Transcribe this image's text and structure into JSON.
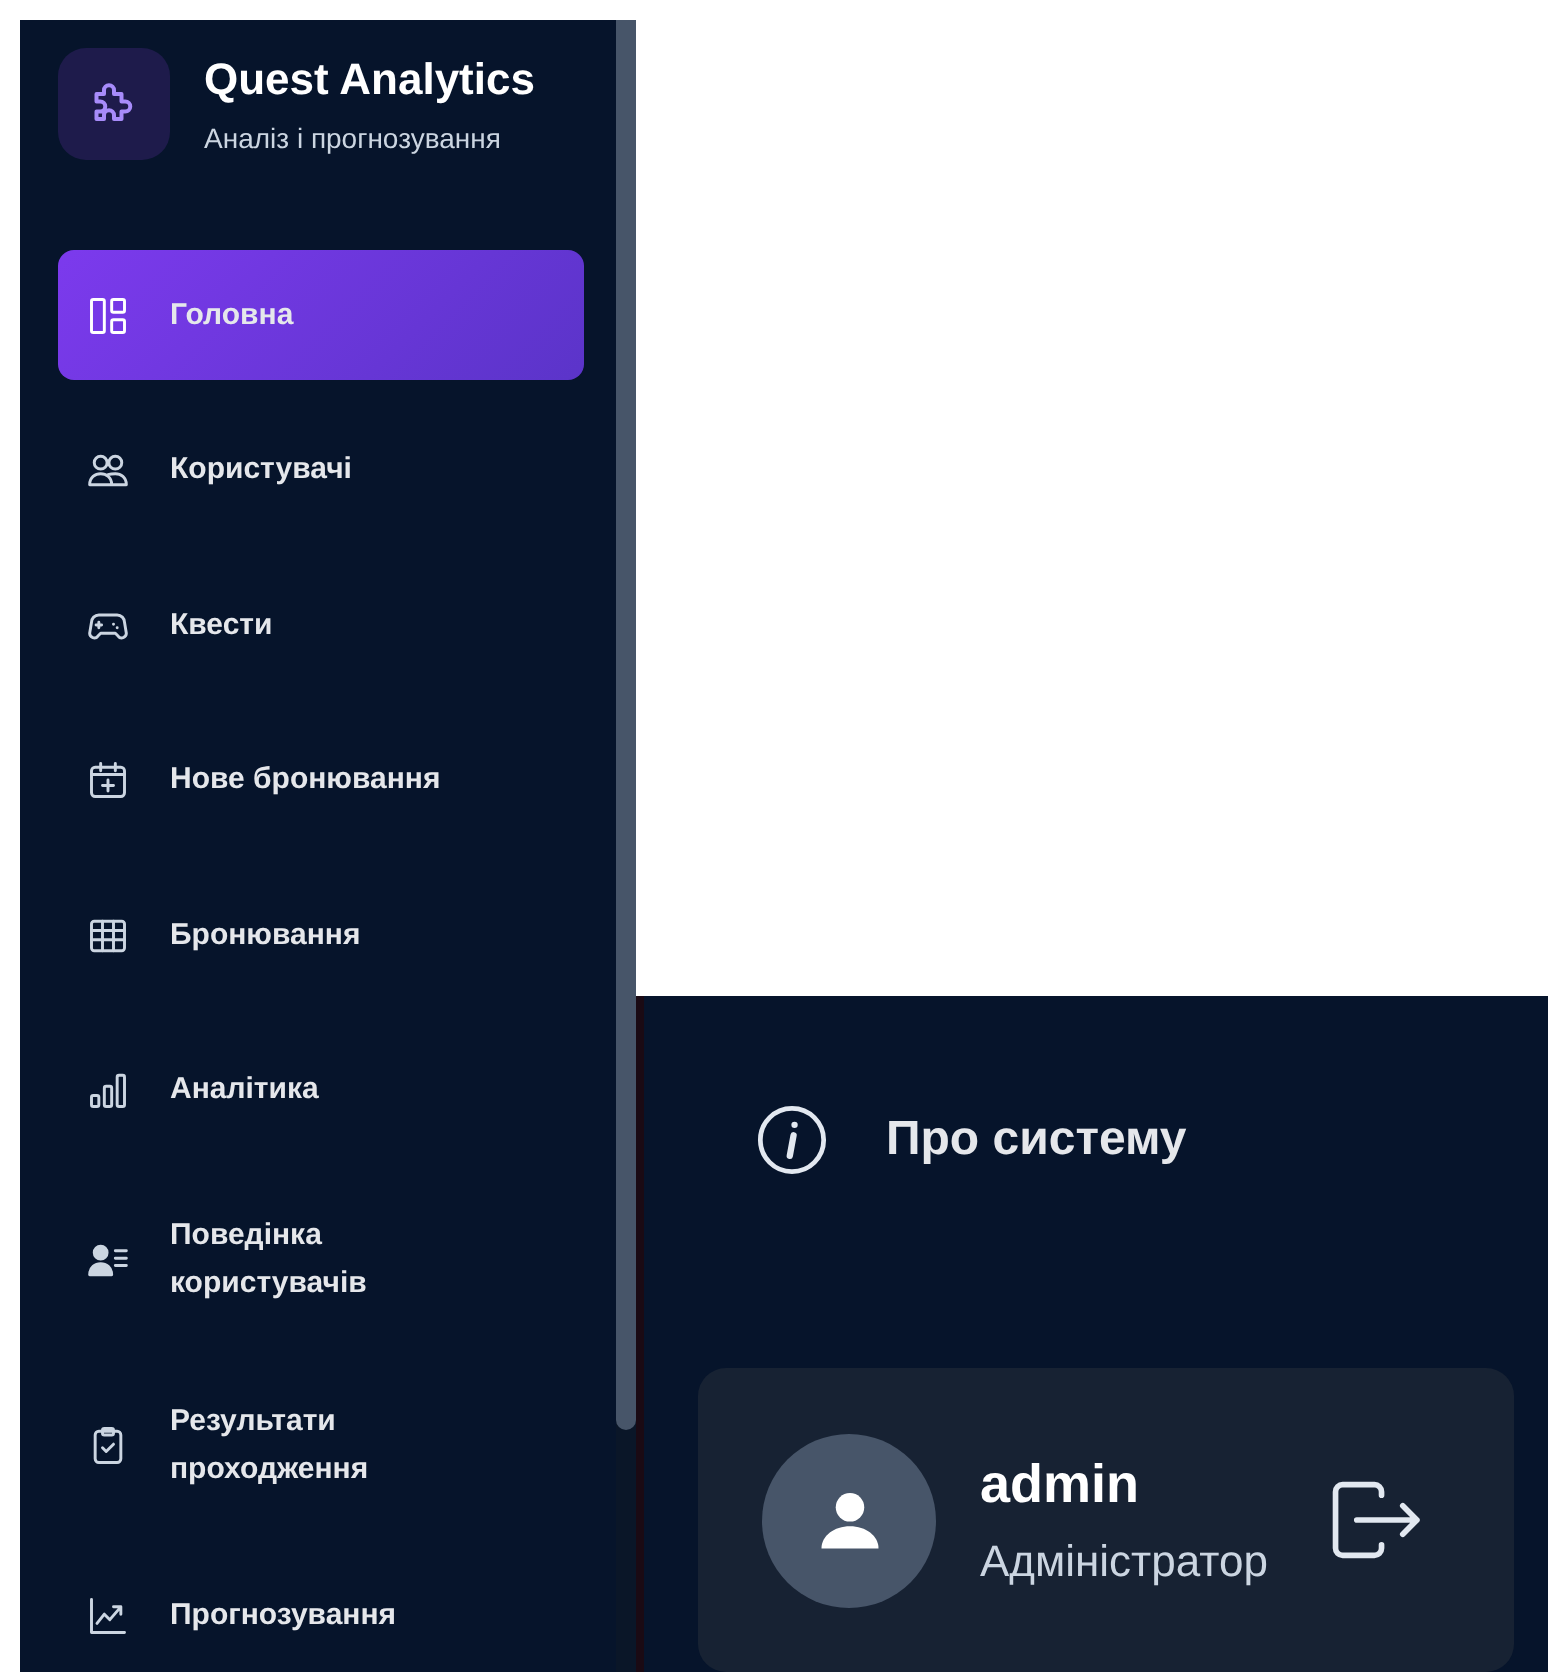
{
  "brand": {
    "title": "Quest Analytics",
    "subtitle": "Аналіз і прогнозування"
  },
  "nav": [
    {
      "label": "Головна",
      "selected": true
    },
    {
      "label": "Користувачі",
      "selected": false
    },
    {
      "label": "Квести",
      "selected": false
    },
    {
      "label": "Нове бронювання",
      "selected": false
    },
    {
      "label": "Бронювання",
      "selected": false
    },
    {
      "label": "Аналітика",
      "selected": false
    },
    {
      "label": "Поведінка користувачів",
      "selected": false
    },
    {
      "label": "Результати проходження",
      "selected": false
    },
    {
      "label": "Прогнозування",
      "selected": false
    }
  ],
  "about": {
    "label": "Про систему"
  },
  "user": {
    "name": "admin",
    "role": "Адміністратор"
  }
}
